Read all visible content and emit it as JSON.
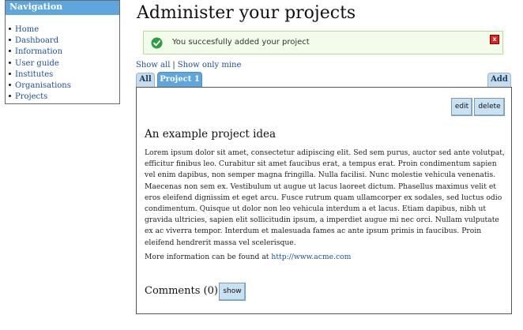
{
  "nav": {
    "title": "Navigation",
    "items": [
      {
        "label": "Home"
      },
      {
        "label": "Dashboard"
      },
      {
        "label": "Information"
      },
      {
        "label": "User guide"
      },
      {
        "label": "Institutes"
      },
      {
        "label": "Organisations"
      },
      {
        "label": "Projects"
      }
    ]
  },
  "page": {
    "title": "Administer your projects"
  },
  "message": {
    "text": "You succesfully added your project",
    "icon": "check-circle-icon",
    "close_icon": "close-icon",
    "close_label": "x",
    "color": "#2e9e44"
  },
  "filters": {
    "show_all": "Show all",
    "separator": "|",
    "show_mine": "Show only mine"
  },
  "tabs": {
    "all": "All",
    "project": "Project 1",
    "add": "Add"
  },
  "project": {
    "edit_label": "edit",
    "delete_label": "delete",
    "title": "An example project idea",
    "description": "Lorem ipsum dolor sit amet, consectetur adipiscing elit. Sed sem purus, auctor sed ante volutpat, efficitur finibus leo. Curabitur sit amet faucibus erat, a tempus erat. Proin condimentum sapien vel enim dapibus, non semper magna fringilla. Nulla facilisi. Nunc molestie vehicula venenatis. Maecenas non sem ex. Vestibulum ut augue ut lacus laoreet dictum. Phasellus maximus velit et eros eleifend dignissim et eget arcu. Fusce rutrum quam ullamcorper ex sodales, sed luctus odio condimentum. Quisque ut dolor non leo vehicula interdum a et lacus. Etiam dapibus, nibh ut gravida ultricies, sapien elit sollicitudin ipsum, a imperdiet augue mi nec orci. Nullam vulputate ex ac viverra tempor. Interdum et malesuada fames ac ante ipsum primis in faucibus. Proin eleifend hendrerit massa vel scelerisque.",
    "more_info_prefix": "More information can be found at",
    "more_info_url": "http://www.acme.com",
    "comments_label": "Comments (0)",
    "show_label": "show"
  }
}
